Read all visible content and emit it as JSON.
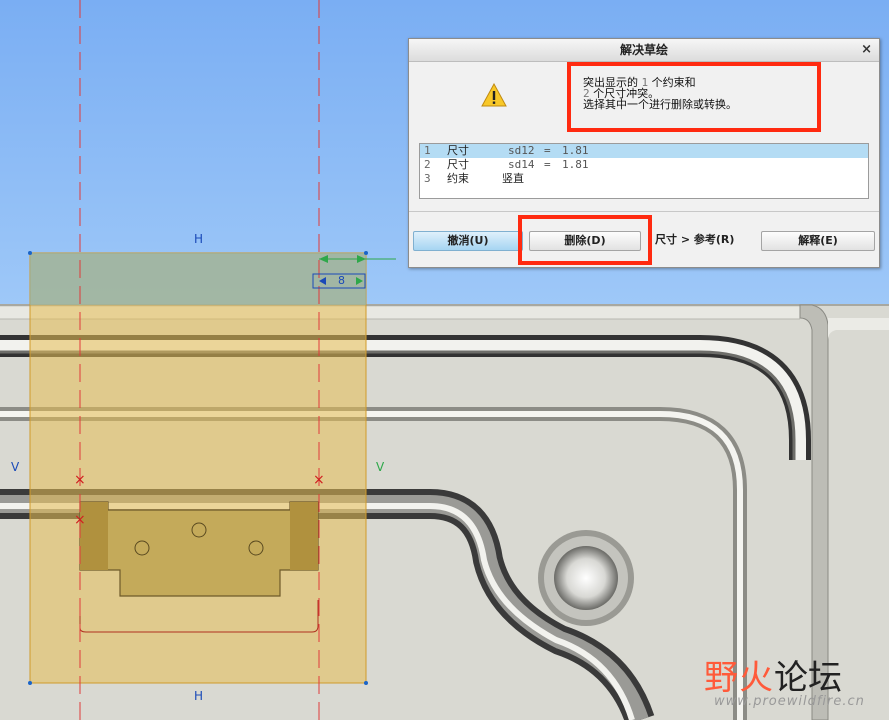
{
  "dialog": {
    "title": "解决草绘",
    "close": "×",
    "message": {
      "line1_prefix": "突出显示的 ",
      "line1_num": "1",
      "line1_suffix": " 个约束和",
      "line2_num": "2",
      "line2_suffix": " 个尺寸冲突。",
      "line3": "选择其中一个进行删除或转换。"
    },
    "items": [
      {
        "index": "1",
        "type": "尺寸",
        "name": "sd12",
        "eq": "=",
        "value": "1.81",
        "selected": true
      },
      {
        "index": "2",
        "type": "尺寸",
        "name": "sd14",
        "eq": "=",
        "value": "1.81",
        "selected": false
      },
      {
        "index": "3",
        "type": "约束",
        "name": "竖直",
        "eq": "",
        "value": "",
        "selected": false
      }
    ],
    "buttons": {
      "cancel": "撤消(U)",
      "delete": "删除(D)",
      "dim_ref": "尺寸 > 参考(R)",
      "explain": "解释(E)"
    }
  },
  "sketch": {
    "top_label": "H",
    "bottom_label": "H",
    "left_label": "V",
    "right_label": "V",
    "dim_value": "8"
  },
  "watermark": {
    "text_red": "野火",
    "text_dark": "论坛",
    "url": "www.proewildfire.cn"
  },
  "colors": {
    "sky": "#90bdf6",
    "part": "#dcdcd4",
    "sketch_fill": "#e8c060",
    "highlight": "#ff2a10",
    "selection": "#b4dcf4"
  }
}
